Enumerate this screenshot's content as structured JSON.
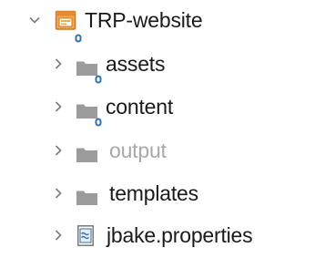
{
  "tree": {
    "root": {
      "label": "TRP-website",
      "expanded": true,
      "icon": "project-folder-icon",
      "badge": "git-repo-badge"
    },
    "children": [
      {
        "label": "assets",
        "icon": "folder-icon",
        "badge": "git-repo-badge",
        "expanded": false
      },
      {
        "label": "content",
        "icon": "folder-icon",
        "badge": "git-repo-badge",
        "expanded": false
      },
      {
        "label": "output",
        "icon": "folder-icon",
        "dimmed": true,
        "expanded": false
      },
      {
        "label": "templates",
        "icon": "folder-icon",
        "expanded": false
      },
      {
        "label": "jbake.properties",
        "icon": "properties-file-icon",
        "expanded": false
      }
    ]
  },
  "colors": {
    "text": "#1a1a1a",
    "dimmed_text": "#a8a8a8",
    "folder": "#9b9b9b",
    "project_orange": "#e8872b",
    "badge_blue": "#2f6fb2",
    "chevron": "#7a7a7a"
  }
}
